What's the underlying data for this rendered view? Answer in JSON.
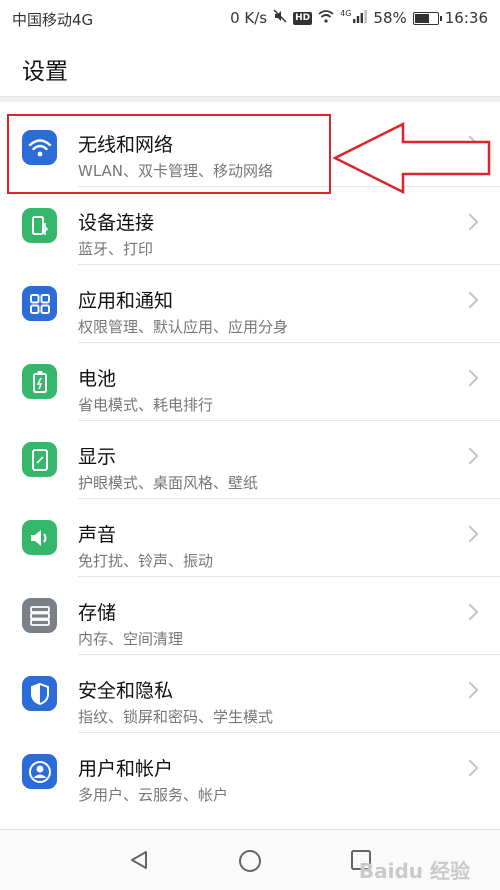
{
  "status_bar": {
    "carrier": "中国移动4G",
    "speed": "0 K/s",
    "hd": "HD",
    "network_small": "4G",
    "battery_text": "58%",
    "battery_level": 0.58,
    "time": "16:36"
  },
  "header": {
    "title": "设置"
  },
  "items": [
    {
      "title": "无线和网络",
      "subtitle": "WLAN、双卡管理、移动网络",
      "icon": "wifi-icon",
      "color": "#2b6cd6"
    },
    {
      "title": "设备连接",
      "subtitle": "蓝牙、打印",
      "icon": "device-connect-icon",
      "color": "#35b76b"
    },
    {
      "title": "应用和通知",
      "subtitle": "权限管理、默认应用、应用分身",
      "icon": "apps-grid-icon",
      "color": "#2b6cd6"
    },
    {
      "title": "电池",
      "subtitle": "省电模式、耗电排行",
      "icon": "battery-icon",
      "color": "#35b76b"
    },
    {
      "title": "显示",
      "subtitle": "护眼模式、桌面风格、壁纸",
      "icon": "display-icon",
      "color": "#35b76b"
    },
    {
      "title": "声音",
      "subtitle": "免打扰、铃声、振动",
      "icon": "speaker-icon",
      "color": "#35b76b"
    },
    {
      "title": "存储",
      "subtitle": "内存、空间清理",
      "icon": "storage-icon",
      "color": "#7b7f86"
    },
    {
      "title": "安全和隐私",
      "subtitle": "指纹、锁屏和密码、学生模式",
      "icon": "shield-icon",
      "color": "#2b6cd6"
    },
    {
      "title": "用户和帐户",
      "subtitle": "多用户、云服务、帐户",
      "icon": "user-icon",
      "color": "#2b6cd6"
    }
  ],
  "nav": {
    "back": "back-icon",
    "home": "home-icon",
    "recents": "recents-icon"
  },
  "watermark": "Baidu 经验"
}
